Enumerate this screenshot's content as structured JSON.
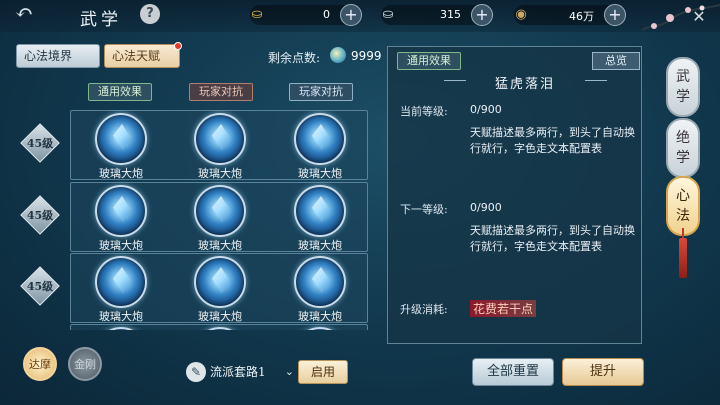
{
  "header": {
    "title": "武学",
    "help": "?",
    "close": "✕"
  },
  "currencies": [
    {
      "name": "gold-ingot",
      "icon": "⛀",
      "value": "0",
      "color": "#d9a93b"
    },
    {
      "name": "silver-ingot",
      "icon": "⛀",
      "value": "315",
      "color": "#c9d0d4"
    },
    {
      "name": "coin",
      "icon": "◉",
      "value": "46万",
      "color": "#c8a25b"
    }
  ],
  "tabs": {
    "mind_realm": "心法境界",
    "mind_talent": "心法天赋"
  },
  "points": {
    "label": "剩余点数:",
    "value": "9999"
  },
  "columns": [
    "通用效果",
    "玩家对抗",
    "玩家对抗"
  ],
  "rows": [
    {
      "level": "45级",
      "cells": [
        "玻璃大炮",
        "玻璃大炮",
        "玻璃大炮"
      ]
    },
    {
      "level": "45级",
      "cells": [
        "玻璃大炮",
        "玻璃大炮",
        "玻璃大炮"
      ]
    },
    {
      "level": "45级",
      "cells": [
        "玻璃大炮",
        "玻璃大炮",
        "玻璃大炮"
      ]
    },
    {
      "level": "",
      "cells": [
        "",
        "",
        ""
      ]
    }
  ],
  "characters": {
    "a": "达摩",
    "b": "金刚"
  },
  "route": {
    "label": "流派套路1",
    "enable": "启用"
  },
  "detail": {
    "tag": "通用效果",
    "overview": "总览",
    "title": "猛虎落泪",
    "current_label": "当前等级:",
    "current_value": "0/900",
    "current_desc": "天赋描述最多两行，到头了自动换行就行，字色走文本配置表",
    "next_label": "下一等级:",
    "next_value": "0/900",
    "next_desc": "天赋描述最多两行，到头了自动换行就行，字色走文本配置表",
    "cost_label": "升级消耗:",
    "cost_value": "花费若干点",
    "reset": "全部重置",
    "upgrade": "提升"
  },
  "side_tabs": [
    {
      "label_top": "武",
      "label_bottom": "学",
      "active": false
    },
    {
      "label_top": "绝",
      "label_bottom": "学",
      "active": false
    },
    {
      "label_top": "心",
      "label_bottom": "法",
      "active": true
    }
  ]
}
